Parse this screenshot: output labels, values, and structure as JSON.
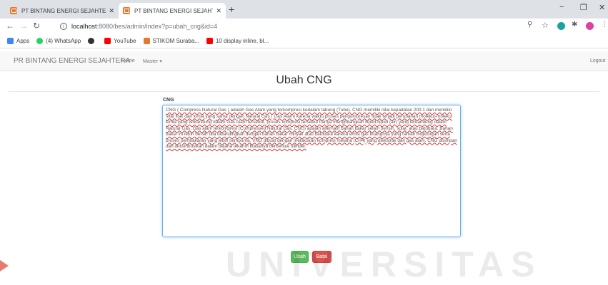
{
  "browser": {
    "tabs": [
      {
        "title": "PT BINTANG ENERGI SEJAHTERA",
        "active": false
      },
      {
        "title": "PT BINTANG ENERGI SEJAHTERA",
        "active": true
      }
    ],
    "new_tab": "+",
    "window_controls": {
      "minimize": "−",
      "maximize": "❐",
      "close": "✕"
    },
    "url_host": "localhost",
    "url_path": ":8080/bes/admin/index?p=ubah_cng&id=4",
    "bookmarks": [
      {
        "label": "Apps",
        "icon": "apps-grid-icon",
        "color": "#4285f4"
      },
      {
        "label": "(4) WhatsApp",
        "icon": "whatsapp-icon",
        "color": "#25d366"
      },
      {
        "label": "",
        "icon": "github-icon",
        "color": "#333333"
      },
      {
        "label": "YouTube",
        "icon": "youtube-icon",
        "color": "#ff0000"
      },
      {
        "label": "STIKOM Suraba...",
        "icon": "stikom-icon",
        "color": "#e8772e"
      },
      {
        "label": "10 display inline, bl...",
        "icon": "youtube-icon",
        "color": "#ff0000"
      }
    ]
  },
  "navbar": {
    "brand": "PR BINTANG ENERGI SEJAHTERA",
    "home": "Home",
    "master": "Master ▾",
    "logout": "Logout"
  },
  "page": {
    "title": "Ubah CNG",
    "field_label": "CNG",
    "field_value": "CNG ( Compress Natural Gas ) adalah Gas Alam yang terkompresi kedalam tabung (Tube). CNG memiliki nilai kepadatan 200:1 dan memiliki sifat fisik dan kimia yang sama dengan Natural Gas ( Gas Alam) karena waktu proses pengompresan tidak terjadi perubahan molekul-molekul kimia yang terkandung dalam Gas Alam tersebut. proses kompresi tersebut hanya menghilangkan liquid-liquid (air) yang terkandung dalam Natural Gas. Gas alam terkompresi (Compressed Natural Gas, CNG) adalah alternatif bahan bakar selain bensin, solar, atau batubara. Bahan bakar ini lebih bersih bila dibandingkan dengan bahan bakar minyak atau batubara karena emisi gas buangnya yang ramah lingkungan serta proses pembakaran yang lebih sempurna. VNG dibuat dengan melakukan kompresi metana (CH4) yang diekstrak dari gas alam. CNG disimpan dan didistribusikan dalam bejana tekanm biasanya berbentuk silinder.",
    "save_label": "Ubah",
    "cancel_label": "Batal"
  },
  "watermark": "UNIVERSITAS",
  "colors": {
    "save": "#5cb85c",
    "cancel": "#d9534f",
    "focus": "#66afe9"
  }
}
